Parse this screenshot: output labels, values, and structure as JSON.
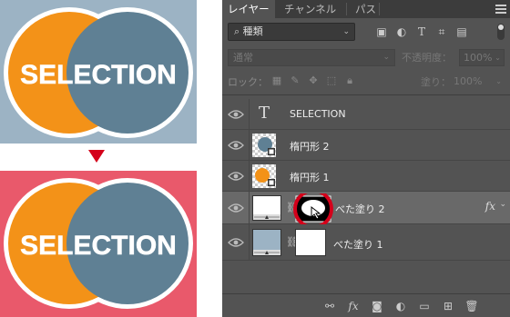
{
  "artwork": {
    "logo_text": "SELECTION",
    "colors": {
      "top_background": "#9cb3c4",
      "bottom_background": "#e9596b",
      "orange_circle": "#f39218",
      "blue_circle": "#5f8094",
      "arrow": "#d4001a"
    }
  },
  "panel": {
    "tabs": [
      {
        "label": "レイヤー",
        "active": true
      },
      {
        "label": "チャンネル",
        "active": false
      },
      {
        "label": "パス",
        "active": false
      }
    ],
    "filter": {
      "kind": "種類"
    },
    "blend_mode": "通常",
    "opacity_label": "不透明度：",
    "opacity_value": "100%",
    "lock_label": "ロック：",
    "fill_label": "塗り：",
    "fill_value": "100%",
    "layers": [
      {
        "name": "SELECTION",
        "type": "text"
      },
      {
        "name": "楕円形 2",
        "type": "shape"
      },
      {
        "name": "楕円形 1",
        "type": "shape"
      },
      {
        "name": "べた塗り 2",
        "type": "fill",
        "selected": true,
        "fx": "fx"
      },
      {
        "name": "べた塗り 1",
        "type": "fill"
      }
    ]
  }
}
